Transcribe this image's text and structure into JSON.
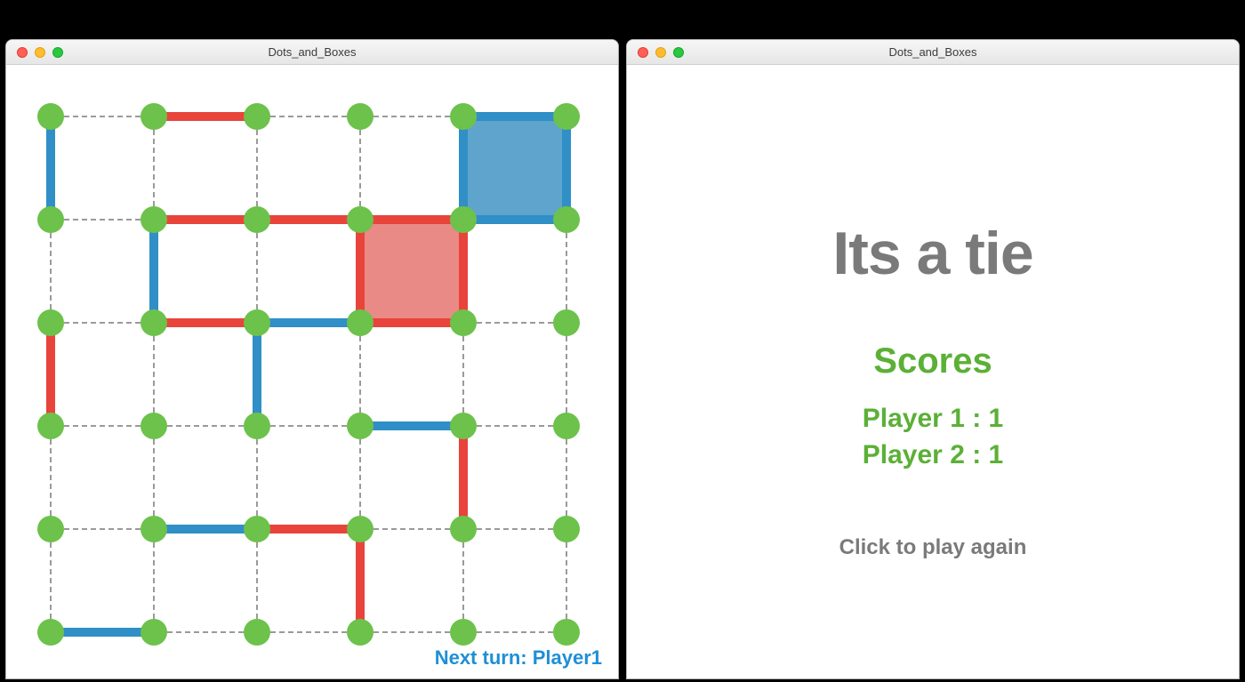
{
  "window_title": "Dots_and_Boxes",
  "colors": {
    "dot": "#6cc24a",
    "player1_edge": "#2f8fc6",
    "player2_edge": "#e8443b",
    "player1_box": "#5fa4cc",
    "player2_box": "#ea8a86",
    "text_muted": "#7a7a7a",
    "text_accent": "#5bb036",
    "turn_text": "#1f8fd6"
  },
  "grid": {
    "cols": 6,
    "rows": 6
  },
  "turn_label": "Next turn: Player1",
  "result": {
    "headline": "Its a tie",
    "scores_header": "Scores",
    "player1_line": "Player 1 : 1",
    "player2_line": "Player 2 : 1",
    "again_text": "Click to play again",
    "scores": {
      "player1": 1,
      "player2": 1
    }
  },
  "h_edges_comment": "h_edges[r][c] owner for segment between (r,c)-(r,c+1); null=unclaimed dashed",
  "h_edges": [
    [
      null,
      "p2",
      null,
      null,
      "p1"
    ],
    [
      null,
      "p2",
      "p2",
      "p2",
      "p1"
    ],
    [
      null,
      "p2",
      "p1",
      "p2",
      null
    ],
    [
      null,
      null,
      null,
      "p1",
      null
    ],
    [
      null,
      "p1",
      "p2",
      null,
      null
    ],
    [
      "p1",
      null,
      null,
      null,
      null
    ]
  ],
  "v_edges_comment": "v_edges[r][c] owner for segment between (r,c)-(r+1,c); null=unclaimed dashed",
  "v_edges": [
    [
      "p1",
      null,
      null,
      null,
      "p1",
      "p1"
    ],
    [
      null,
      "p1",
      null,
      "p2",
      "p2",
      null
    ],
    [
      "p2",
      null,
      "p1",
      null,
      null,
      null
    ],
    [
      null,
      null,
      null,
      null,
      "p2",
      null
    ],
    [
      null,
      null,
      null,
      "p2",
      null,
      null
    ]
  ],
  "boxes_comment": "boxes[r][c] owner if box completed",
  "boxes": [
    [
      null,
      null,
      null,
      null,
      "p1"
    ],
    [
      null,
      null,
      null,
      "p2",
      null
    ],
    [
      null,
      null,
      null,
      null,
      null
    ],
    [
      null,
      null,
      null,
      null,
      null
    ],
    [
      null,
      null,
      null,
      null,
      null
    ]
  ]
}
